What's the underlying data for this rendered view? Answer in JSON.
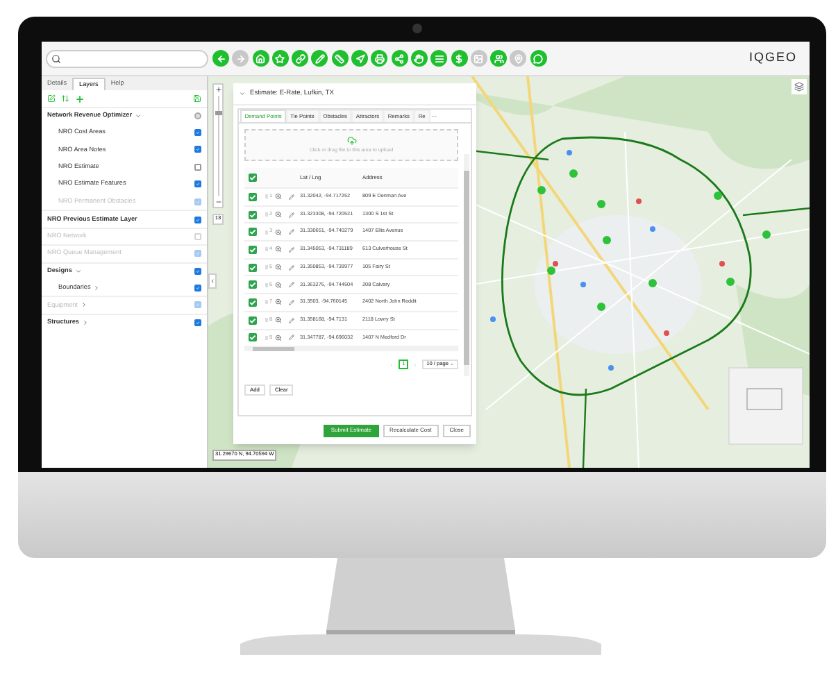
{
  "toolbar": [
    {
      "kind": "back",
      "disabled": false
    },
    {
      "kind": "forward",
      "disabled": true
    },
    {
      "kind": "home",
      "disabled": false
    },
    {
      "kind": "star",
      "disabled": false
    },
    {
      "kind": "link",
      "disabled": false
    },
    {
      "kind": "pencil",
      "disabled": false
    },
    {
      "kind": "ruler",
      "disabled": false
    },
    {
      "kind": "navigate",
      "disabled": false
    },
    {
      "kind": "print",
      "disabled": false
    },
    {
      "kind": "share",
      "disabled": false
    },
    {
      "kind": "hand",
      "disabled": false
    },
    {
      "kind": "list",
      "disabled": false
    },
    {
      "kind": "dollar",
      "disabled": false
    },
    {
      "kind": "image",
      "disabled": true
    },
    {
      "kind": "people",
      "disabled": false
    },
    {
      "kind": "pin",
      "disabled": true
    },
    {
      "kind": "chat",
      "disabled": false
    }
  ],
  "logo": "IQGEO",
  "panel_tabs": [
    {
      "label": "Details",
      "selected": false
    },
    {
      "label": "Layers",
      "selected": true
    },
    {
      "label": "Help",
      "selected": false
    }
  ],
  "layers": [
    {
      "kind": "group",
      "name": "Network Revenue Optimizer",
      "expanded": true,
      "checked": false,
      "mixed": true,
      "disabled": false,
      "children": [
        {
          "kind": "layer",
          "name": "NRO Cost Areas",
          "checked": true,
          "mixed": false,
          "disabled": false
        },
        {
          "kind": "layer",
          "name": "NRO Area Notes",
          "checked": true,
          "mixed": false,
          "disabled": false
        },
        {
          "kind": "layer",
          "name": "NRO Estimate",
          "checked": false,
          "mixed": false,
          "disabled": false
        },
        {
          "kind": "layer",
          "name": "NRO Estimate Features",
          "checked": true,
          "mixed": false,
          "disabled": false
        },
        {
          "kind": "layer",
          "name": "NRO Permanent Obstacles",
          "checked": true,
          "mixed": false,
          "disabled": true
        }
      ]
    },
    {
      "kind": "layer",
      "name": "NRO Previous Estimate Layer",
      "checked": true,
      "mixed": false,
      "disabled": false
    },
    {
      "kind": "layer",
      "name": "NRO Network",
      "checked": false,
      "mixed": false,
      "disabled": true
    },
    {
      "kind": "layer",
      "name": "NRO Queue Management",
      "checked": true,
      "mixed": false,
      "disabled": true
    },
    {
      "kind": "group",
      "name": "Designs",
      "expanded": true,
      "checked": true,
      "mixed": false,
      "disabled": false,
      "children": [
        {
          "kind": "group",
          "name": "Boundaries",
          "expanded": false,
          "checked": true,
          "mixed": false,
          "disabled": false
        }
      ]
    },
    {
      "kind": "group",
      "name": "Equipment",
      "expanded": false,
      "checked": true,
      "mixed": false,
      "disabled": true
    },
    {
      "kind": "group",
      "name": "Structures",
      "expanded": false,
      "checked": true,
      "mixed": false,
      "disabled": false
    }
  ],
  "map": {
    "zoom_slider": {
      "level": 0.85
    },
    "zoom_level": "13",
    "coordinates": "31.29670 N, 94.70594 W"
  },
  "dialog": {
    "title": "Estimate: E-Rate, Lufkin, TX",
    "tabs": [
      {
        "label": "Demand Points",
        "selected": true
      },
      {
        "label": "Tie Points",
        "selected": false
      },
      {
        "label": "Obstacles",
        "selected": false
      },
      {
        "label": "Attractors",
        "selected": false
      },
      {
        "label": "Remarks",
        "selected": false
      },
      {
        "label": "Re",
        "selected": false
      }
    ],
    "more_tabs": "···",
    "upload_hint": "Click or drag file to this area to upload",
    "header_checked": true,
    "columns": [
      "Lat / Lng",
      "Address"
    ],
    "rows": [
      {
        "checked": true,
        "index": "1",
        "latlng": "31.32042, -94.717252",
        "address": "809 E Denman Ave"
      },
      {
        "checked": true,
        "index": "2",
        "latlng": "31.323308, -94.720521",
        "address": "1300 S 1st St"
      },
      {
        "checked": true,
        "index": "3",
        "latlng": "31.330651, -94.740279",
        "address": "1407 Ellis Avenue"
      },
      {
        "checked": true,
        "index": "4",
        "latlng": "31.345053, -94.731189",
        "address": "613 Culverhouse St"
      },
      {
        "checked": true,
        "index": "5",
        "latlng": "31.350853, -94.739977",
        "address": "105 Fairy St"
      },
      {
        "checked": true,
        "index": "6",
        "latlng": "31.363275, -94.744504",
        "address": "208 Calvary"
      },
      {
        "checked": true,
        "index": "7",
        "latlng": "31.3503, -94.760145",
        "address": "2402 North John Reddit"
      },
      {
        "checked": true,
        "index": "8",
        "latlng": "31.358168, -94.7131",
        "address": "2118 Lowry St"
      },
      {
        "checked": true,
        "index": "9",
        "latlng": "31.347787, -94.696032",
        "address": "1407 N Medford Dr"
      }
    ],
    "pages": [
      {
        "label": "1",
        "selected": true
      }
    ],
    "page_size": "10 / page",
    "table_buttons": [
      "Add",
      "Clear"
    ],
    "footer_buttons": [
      {
        "label": "Submit Estimate",
        "primary": true
      },
      {
        "label": "Recalculate Cost",
        "primary": false
      },
      {
        "label": "Close",
        "primary": false
      }
    ]
  }
}
